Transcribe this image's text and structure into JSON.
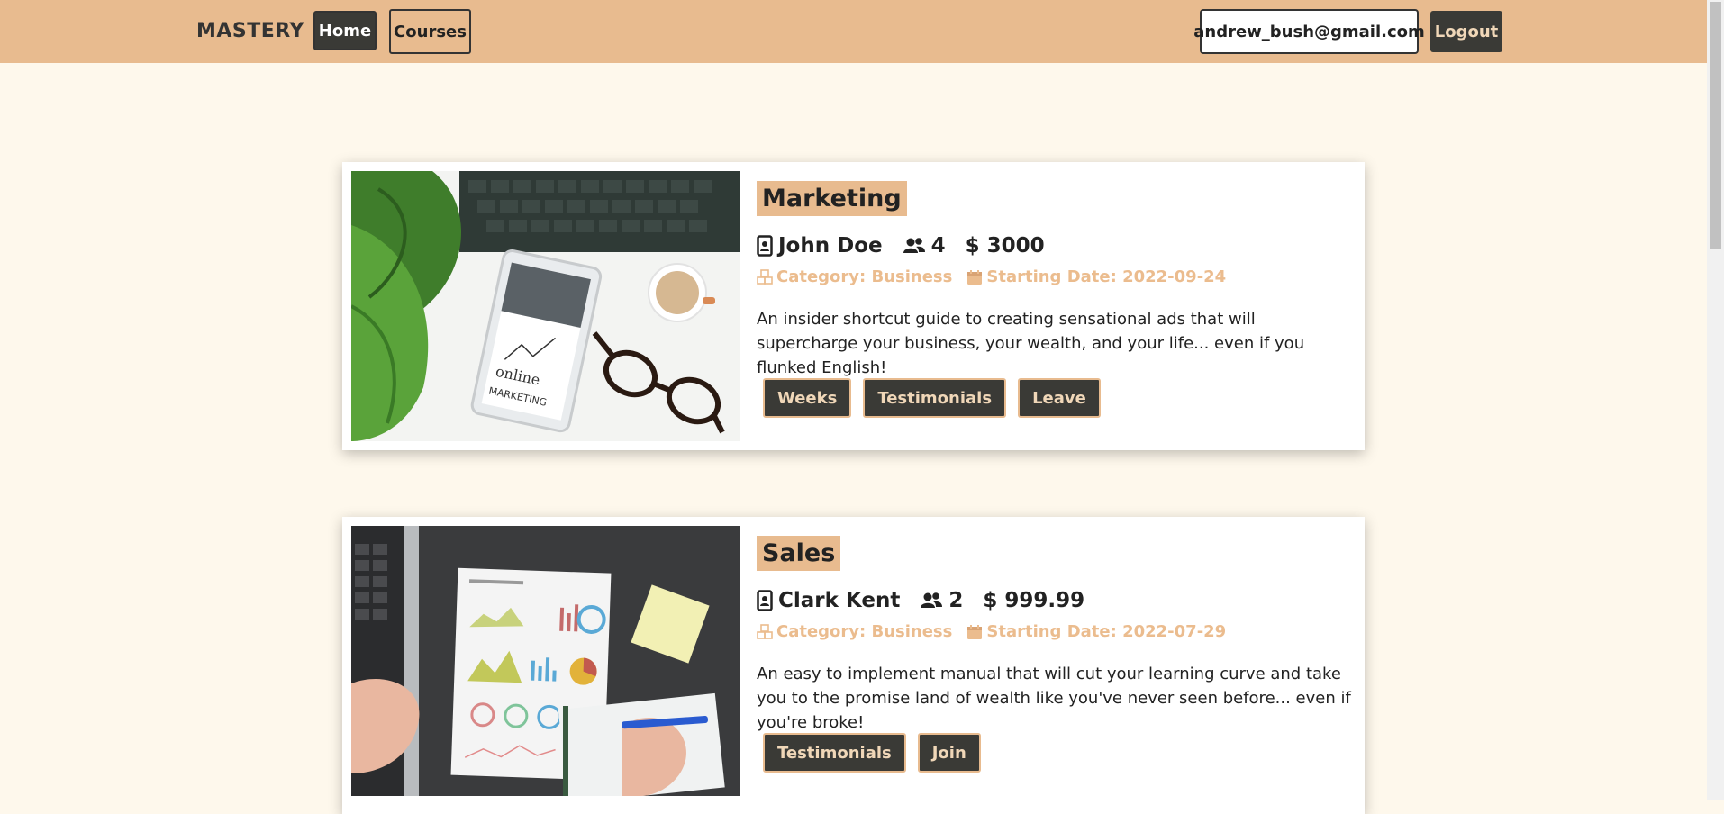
{
  "nav": {
    "brand": "MASTERY",
    "home_label": "Home",
    "courses_label": "Courses",
    "user_email": "andrew_bush@gmail.com",
    "logout_label": "Logout"
  },
  "courses": [
    {
      "title": "Marketing",
      "instructor": "John Doe",
      "students": "4",
      "price": "$ 3000",
      "category": "Category: Business",
      "start_date": "Starting Date: 2022-09-24",
      "description": "An insider shortcut guide to creating sensational ads that will supercharge your business, your wealth, and your life... even if you flunked English!",
      "actions": [
        "Weeks",
        "Testimonials",
        "Leave"
      ],
      "image_icon": "online-marketing-photo"
    },
    {
      "title": "Sales",
      "instructor": "Clark Kent",
      "students": "2",
      "price": "$ 999.99",
      "category": "Category: Business",
      "start_date": "Starting Date: 2022-07-29",
      "description": "An easy to implement manual that will cut your learning curve and take you to the promise land of wealth like you've never seen before... even if you're broke!",
      "actions": [
        "Testimonials",
        "Join"
      ],
      "image_icon": "sales-charts-photo"
    }
  ],
  "colors": {
    "navbar": "#e8bb8f",
    "page_bg": "#fef8ec",
    "button_dark": "#3a3a36",
    "accent_text": "#ebbc8e"
  }
}
